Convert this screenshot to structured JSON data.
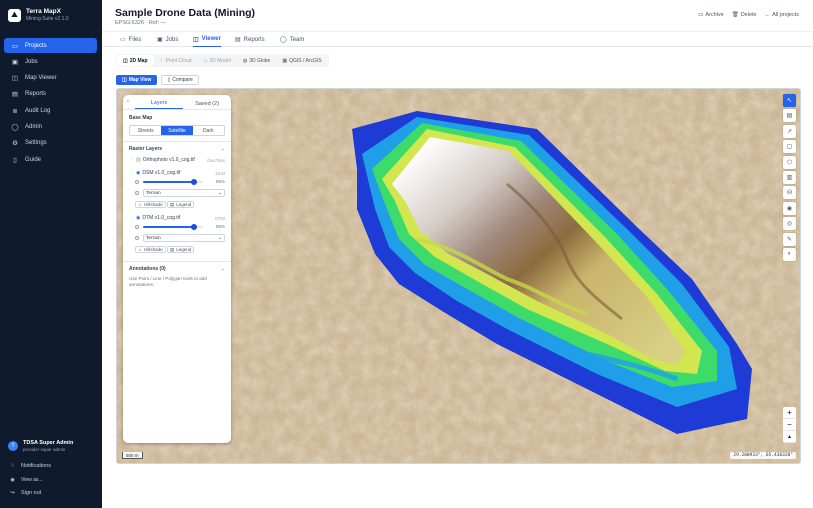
{
  "sidebar": {
    "brand_name": "Terra MapX",
    "brand_sub": "Mining Suite v2.1.0",
    "nav": [
      {
        "label": "Projects",
        "icon": "folder-icon",
        "glyph": "▭",
        "active": true
      },
      {
        "label": "Jobs",
        "icon": "briefcase-icon",
        "glyph": "▣"
      },
      {
        "label": "Map Viewer",
        "icon": "map-icon",
        "glyph": "◫"
      },
      {
        "label": "Reports",
        "icon": "file-icon",
        "glyph": "▤"
      },
      {
        "label": "Audit Log",
        "icon": "list-icon",
        "glyph": "≣"
      },
      {
        "label": "Admin",
        "icon": "user-icon",
        "glyph": "◯"
      },
      {
        "label": "Settings",
        "icon": "gear-icon",
        "glyph": "⚙"
      },
      {
        "label": "Guide",
        "icon": "book-icon",
        "glyph": "▯"
      }
    ],
    "user_initial": "T",
    "user_name": "TDSA Super Admin",
    "user_email": "provider super admin",
    "notifications": "Notifications",
    "view_as": "View as...",
    "sign_out": "Sign out"
  },
  "header": {
    "title": "Sample Drone Data (Mining)",
    "subtitle": "EPSG:6326 · Ref: —",
    "archive": "Archive",
    "delete": "Delete",
    "back": "All projects"
  },
  "tabs": [
    {
      "label": "Files",
      "glyph": "▭"
    },
    {
      "label": "Jobs",
      "glyph": "▣"
    },
    {
      "label": "Viewer",
      "glyph": "◫",
      "active": true
    },
    {
      "label": "Reports",
      "glyph": "▤"
    },
    {
      "label": "Team",
      "glyph": "◯"
    }
  ],
  "subtabs": [
    {
      "label": "2D Map",
      "glyph": "◫",
      "state": "active"
    },
    {
      "label": "Point Cloud",
      "glyph": "⁘",
      "state": "disabled"
    },
    {
      "label": "3D Model",
      "glyph": "◇",
      "state": "disabled"
    },
    {
      "label": "3D Globe",
      "glyph": "◍",
      "state": "enabled"
    },
    {
      "label": "QGIS / ArcGIS",
      "glyph": "▦",
      "state": "enabled"
    }
  ],
  "viewbtns": {
    "map_view": "Map View",
    "compare": "Compare"
  },
  "panel": {
    "tab_layers": "Layers",
    "tab_saved": "Saved (2)",
    "base_map": "Base Map",
    "basemaps": [
      {
        "label": "Streets"
      },
      {
        "label": "Satellite",
        "active": true
      },
      {
        "label": "Dark"
      }
    ],
    "raster_layers": "Raster Layers",
    "ortho": {
      "name": "Orthophoto v1.0_cog.tif",
      "meta": "GeoTiles"
    },
    "dsm": {
      "name": "DSM v1.0_cog.tif",
      "meta": "DLM",
      "opacity_label": "85%",
      "opacity": 0.85,
      "mode": "Terrain"
    },
    "dtm": {
      "name": "DTM v1.0_cog.tif",
      "meta": "DTM",
      "opacity_label": "85%",
      "opacity": 0.85,
      "mode": "Terrain"
    },
    "hillshade": "Hillshade",
    "legend": "Legend",
    "annotations": "Annotations (0)",
    "hint": "Use Point / Line / Polygon tools to add annotations."
  },
  "map": {
    "scale": "500 m",
    "coords": "29.200933°, 65.436320°",
    "tools": [
      {
        "name": "pointer-icon",
        "glyph": "↖",
        "active": true
      },
      {
        "name": "layers-tool-icon",
        "glyph": "▤"
      },
      {
        "name": "line-tool-icon",
        "glyph": "↗"
      },
      {
        "name": "square-tool-icon",
        "glyph": "▢"
      },
      {
        "name": "polygon-tool-icon",
        "glyph": "⬡"
      },
      {
        "name": "chart-tool-icon",
        "glyph": "▥"
      },
      {
        "name": "volume-tool-icon",
        "glyph": "⛁"
      },
      {
        "name": "globe-tool-icon",
        "glyph": "◉"
      },
      {
        "name": "target-tool-icon",
        "glyph": "◎"
      },
      {
        "name": "pen-tool-icon",
        "glyph": "✎"
      },
      {
        "name": "eye-tool-icon",
        "glyph": "◐"
      }
    ],
    "zoom_in": "+",
    "zoom_out": "−",
    "compass": "▲"
  }
}
